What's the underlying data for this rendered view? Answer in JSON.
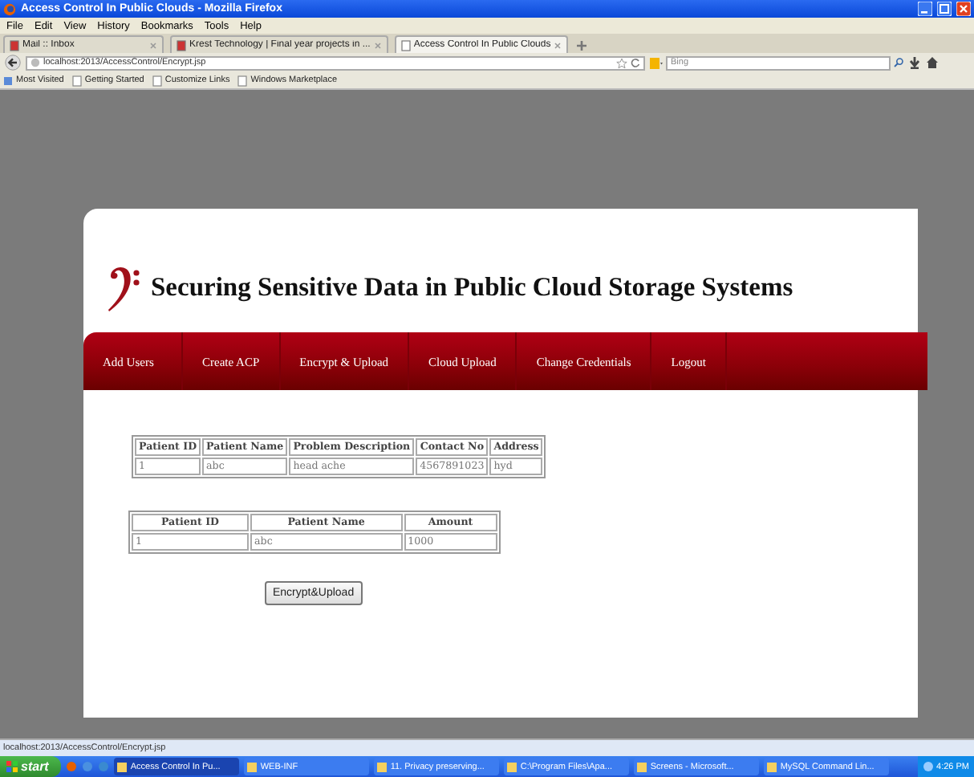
{
  "window": {
    "title": "Access Control In Public Clouds - Mozilla Firefox"
  },
  "menu": [
    "File",
    "Edit",
    "View",
    "History",
    "Bookmarks",
    "Tools",
    "Help"
  ],
  "tabs": [
    {
      "label": "Mail :: Inbox",
      "selected": false
    },
    {
      "label": "Krest Technology | Final year projects in ...",
      "selected": false
    },
    {
      "label": "Access Control In Public Clouds",
      "selected": true
    }
  ],
  "address": "localhost:2013/AccessControl/Encrypt.jsp",
  "search": {
    "placeholder": "Bing"
  },
  "bookmarks": [
    "Most Visited",
    "Getting Started",
    "Customize Links",
    "Windows Marketplace"
  ],
  "page": {
    "heading": "Securing Sensitive Data in Public Cloud Storage Systems",
    "nav": [
      "Add Users",
      "Create ACP",
      "Encrypt & Upload",
      "Cloud Upload",
      "Change Credentials",
      "Logout"
    ],
    "tables": [
      {
        "columns": [
          "Patient ID",
          "Patient Name",
          "Problem Description",
          "Contact No",
          "Address"
        ],
        "rows": [
          [
            "1",
            "abc",
            "head ache",
            "4567891023",
            "hyd"
          ]
        ]
      },
      {
        "columns": [
          "Patient ID",
          "Patient Name",
          "Amount"
        ],
        "rows": [
          [
            "1",
            "abc",
            "1000"
          ]
        ]
      }
    ],
    "button": "Encrypt&Upload"
  },
  "status_bar": "localhost:2013/AccessControl/Encrypt.jsp",
  "taskbar": {
    "start": "start",
    "items": [
      "Access Control In Pu...",
      "WEB-INF",
      "11. Privacy preserving...",
      "C:\\Program Files\\Apa...",
      "Screens - Microsoft...",
      "MySQL Command Lin..."
    ],
    "clock": "4:26 PM"
  }
}
